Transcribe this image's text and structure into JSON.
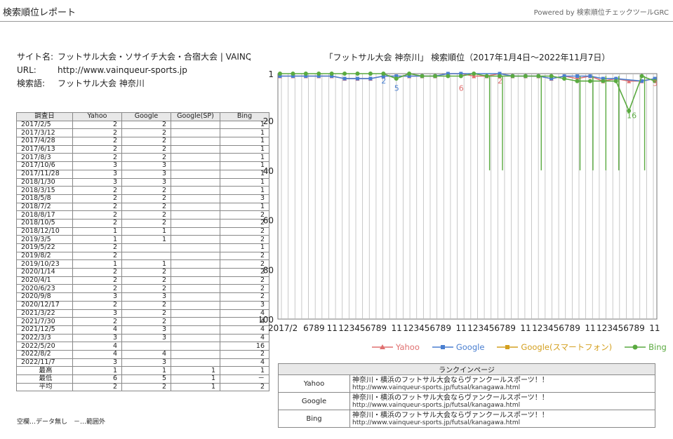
{
  "header": {
    "title": "検索順位レポート",
    "powered": "Powered by 検索順位チェックツールGRC"
  },
  "meta": {
    "site_label": "サイト名:",
    "site_value": "フットサル大会・ソサイチ大会・合宿大会 | VAINQ",
    "url_label": "URL:",
    "url_value": "http://www.vainqueur-sports.jp",
    "kw_label": "検索語:",
    "kw_value": "フットサル大会 神奈川"
  },
  "table": {
    "headers": [
      "調査日",
      "Yahoo",
      "Google",
      "Google(SP)",
      "Bing"
    ],
    "rows": [
      [
        "2017/2/5",
        "2",
        "2",
        "",
        "1"
      ],
      [
        "2017/3/12",
        "2",
        "2",
        "",
        "1"
      ],
      [
        "2017/4/28",
        "2",
        "2",
        "",
        "1"
      ],
      [
        "2017/6/13",
        "2",
        "2",
        "",
        "1"
      ],
      [
        "2017/8/3",
        "2",
        "2",
        "",
        "1"
      ],
      [
        "2017/10/6",
        "3",
        "3",
        "",
        "1"
      ],
      [
        "2017/11/28",
        "3",
        "3",
        "",
        "1"
      ],
      [
        "2018/1/30",
        "3",
        "3",
        "",
        "1"
      ],
      [
        "2018/3/15",
        "2",
        "2",
        "",
        "1"
      ],
      [
        "2018/5/8",
        "2",
        "2",
        "",
        "3"
      ],
      [
        "2018/7/2",
        "2",
        "2",
        "",
        "1"
      ],
      [
        "2018/8/17",
        "2",
        "2",
        "",
        "2"
      ],
      [
        "2018/10/5",
        "2",
        "2",
        "",
        "2"
      ],
      [
        "2018/12/10",
        "1",
        "1",
        "",
        "2"
      ],
      [
        "2019/3/5",
        "1",
        "1",
        "",
        "2"
      ],
      [
        "2019/5/22",
        "2",
        "",
        "",
        "1"
      ],
      [
        "2019/8/2",
        "2",
        "",
        "",
        "2"
      ],
      [
        "2019/10/23",
        "1",
        "1",
        "",
        "2"
      ],
      [
        "2020/1/14",
        "2",
        "2",
        "",
        "2"
      ],
      [
        "2020/4/1",
        "2",
        "2",
        "",
        "2"
      ],
      [
        "2020/6/23",
        "2",
        "2",
        "",
        "2"
      ],
      [
        "2020/9/8",
        "3",
        "3",
        "",
        "2"
      ],
      [
        "2020/12/17",
        "2",
        "2",
        "",
        "3"
      ],
      [
        "2021/3/22",
        "3",
        "2",
        "",
        "4"
      ],
      [
        "2021/7/30",
        "2",
        "2",
        "",
        "4"
      ],
      [
        "2021/12/5",
        "4",
        "3",
        "",
        "4"
      ],
      [
        "2022/3/3",
        "3",
        "3",
        "",
        "4"
      ],
      [
        "2022/5/20",
        "4",
        "",
        "",
        "16"
      ],
      [
        "2022/8/2",
        "4",
        "4",
        "",
        "2"
      ],
      [
        "2022/11/7",
        "3",
        "3",
        "",
        "4"
      ]
    ],
    "summary": [
      [
        "最高",
        "1",
        "1",
        "1",
        "1"
      ],
      [
        "最低",
        "6",
        "5",
        "1",
        "－"
      ],
      [
        "平均",
        "2",
        "2",
        "1",
        "2"
      ]
    ]
  },
  "note": "空欄…データ無し　－…範囲外",
  "chart_data": {
    "type": "line",
    "title": "「フットサル大会 神奈川」 検索順位（2017年1月4日～2022年11月7日）",
    "y_ticks": [
      "1",
      "20",
      "40",
      "60",
      "80",
      "100"
    ],
    "ylim": [
      1,
      100
    ],
    "y_inverted": true,
    "x_tick_labels": [
      "2017/2",
      "6",
      "7",
      "8",
      "9",
      "11",
      "1",
      "2",
      "3",
      "4",
      "5",
      "6",
      "7",
      "8",
      "9",
      "11",
      "1",
      "2",
      "3",
      "4",
      "5",
      "6",
      "7",
      "8",
      "9",
      "11",
      "1",
      "2",
      "3",
      "4",
      "5",
      "6",
      "7",
      "8",
      "9",
      "11",
      "1",
      "2",
      "3",
      "4",
      "5",
      "6",
      "7",
      "8",
      "9",
      "11",
      "1",
      "2",
      "3",
      "4",
      "5",
      "6",
      "7",
      "8",
      "9",
      "11"
    ],
    "x_tick_display": [
      "2017/2",
      "6789",
      "11",
      "123456789",
      "11",
      "123456789",
      "11",
      "123456789",
      "11",
      "123456789",
      "11",
      "123456789",
      "11"
    ],
    "grid": true,
    "legend_position": "bottom",
    "colors": {
      "Yahoo": "#e07070",
      "Google": "#4a7fd0",
      "Google(SP)": "#d4a020",
      "Bing": "#5aaa40"
    },
    "series": [
      {
        "name": "Yahoo",
        "values": [
          2,
          2,
          2,
          2,
          2,
          3,
          3,
          3,
          2,
          2,
          2,
          2,
          2,
          1,
          1,
          2,
          2,
          1,
          2,
          2,
          2,
          3,
          2,
          3,
          2,
          4,
          3,
          4,
          4,
          3
        ]
      },
      {
        "name": "Google",
        "values": [
          2,
          2,
          2,
          2,
          2,
          3,
          3,
          3,
          2,
          2,
          2,
          2,
          2,
          1,
          1,
          null,
          null,
          1,
          2,
          2,
          2,
          3,
          2,
          2,
          2,
          3,
          3,
          null,
          4,
          3
        ]
      },
      {
        "name": "Google(スマートフォン)",
        "values": []
      },
      {
        "name": "Bing",
        "values": [
          1,
          1,
          1,
          1,
          1,
          1,
          1,
          1,
          1,
          3,
          1,
          2,
          2,
          2,
          2,
          1,
          2,
          2,
          2,
          2,
          2,
          2,
          3,
          4,
          4,
          4,
          4,
          16,
          2,
          4
        ]
      }
    ],
    "annotations": [
      "2",
      "5",
      "6",
      "2",
      "3",
      "16"
    ]
  },
  "legend": [
    "Yahoo",
    "Google",
    "Google(スマートフォン)",
    "Bing"
  ],
  "landing": {
    "header": "ランクインページ",
    "rows": [
      {
        "engine": "Yahoo",
        "title": "神奈川・横浜のフットサル大会ならヴァンクールスポーツ！！",
        "url": "http://www.vainqueur-sports.jp/futsal/kanagawa.html"
      },
      {
        "engine": "Google",
        "title": "神奈川・横浜のフットサル大会ならヴァンクールスポーツ！！",
        "url": "http://www.vainqueur-sports.jp/futsal/kanagawa.html"
      },
      {
        "engine": "Bing",
        "title": "神奈川・横浜のフットサル大会ならヴァンクールスポーツ！！",
        "url": "http://www.vainqueur-sports.jp/futsal/kanagawa.html"
      }
    ]
  }
}
